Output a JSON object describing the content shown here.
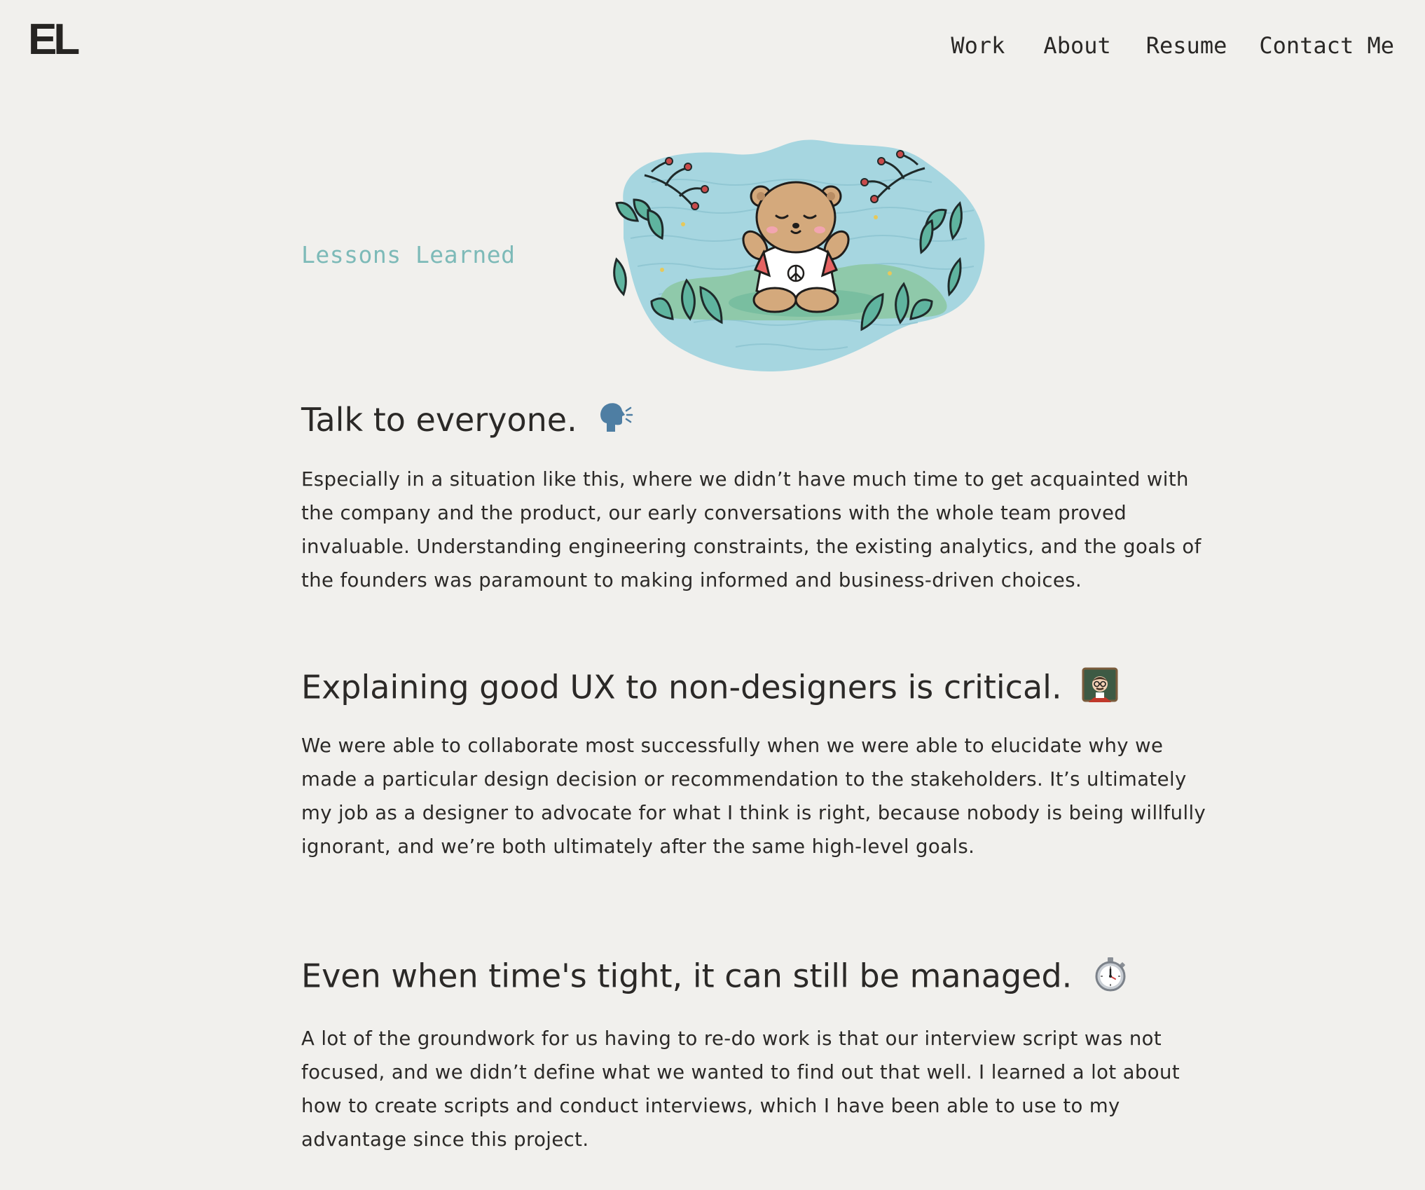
{
  "header": {
    "logo": "EL",
    "nav": [
      {
        "label": "Work"
      },
      {
        "label": "About"
      },
      {
        "label": "Resume"
      },
      {
        "label": "Contact Me"
      }
    ]
  },
  "section": {
    "label": "Lessons Learned",
    "illustration": "meditating-bear-illustration"
  },
  "lessons": [
    {
      "title": "Talk to everyone.",
      "icon": "speaking-head-icon",
      "body": "Especially in a situation like this, where we didn’t have much time to get acquainted with the company and the product, our early conversations with the whole team proved invaluable.  Understanding engineering constraints, the existing analytics, and the goals of the founders was paramount to making informed and business-driven choices."
    },
    {
      "title": "Explaining good UX to non-designers is critical.",
      "icon": "teacher-icon",
      "body": "We were able to collaborate most successfully when we were able to elucidate why we made a particular design decision or recommendation to the stakeholders.  It’s ultimately my job as a designer to advocate for what I think is right, because nobody is being willfully ignorant, and we’re both ultimately after the same high-level goals."
    },
    {
      "title": "Even when time's tight, it can still be managed.",
      "icon": "stopwatch-icon",
      "body": "A lot of the groundwork for us having to re-do work is that our interview script was not focused, and we didn’t define what we wanted to find out that well.  I learned a lot about how to create scripts and conduct interviews, which I have been able to use to my advantage since this project."
    }
  ],
  "colors": {
    "background": "#f1f0ed",
    "text": "#2b2927",
    "accent": "#7dbab8"
  }
}
